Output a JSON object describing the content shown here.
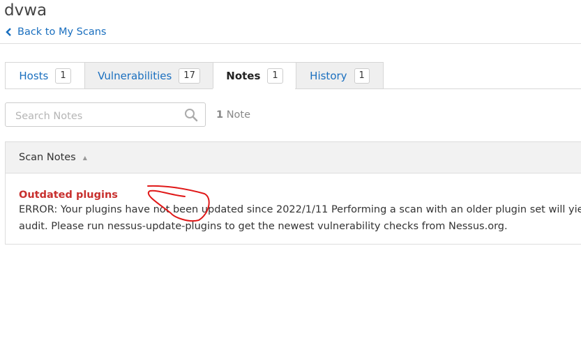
{
  "header": {
    "scan_title": "dvwa",
    "back_link": "Back to My Scans"
  },
  "tabs": [
    {
      "label": "Hosts",
      "count": "1",
      "active": false
    },
    {
      "label": "Vulnerabilities",
      "count": "17",
      "active": false
    },
    {
      "label": "Notes",
      "count": "1",
      "active": true
    },
    {
      "label": "History",
      "count": "1",
      "active": false
    }
  ],
  "search": {
    "placeholder": "Search Notes",
    "value": ""
  },
  "note_count": {
    "number": "1",
    "label": "Note"
  },
  "table": {
    "column_header": "Scan Notes",
    "sort_icon": "sort-ascending-icon",
    "notes": [
      {
        "title": "Outdated plugins",
        "body_line1": "ERROR: Your plugins have not been updated since 2022/1/11 Performing a scan with an older plugin set will yield",
        "body_line2": "audit. Please run nessus-update-plugins to get the newest vulnerability checks from Nessus.org."
      }
    ]
  },
  "colors": {
    "link": "#1a6fbf",
    "note_title": "#c8302e",
    "annotation": "#e01818"
  }
}
